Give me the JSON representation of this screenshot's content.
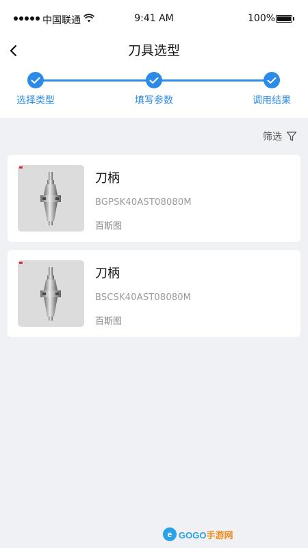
{
  "status_bar": {
    "carrier": "中国联通",
    "time": "9:41 AM",
    "battery": "100%"
  },
  "nav": {
    "title": "刀具选型",
    "back_icon": "chevron-left-icon"
  },
  "steps": [
    {
      "label": "选择类型",
      "completed": true
    },
    {
      "label": "填写参数",
      "completed": true
    },
    {
      "label": "调用结果",
      "completed": true
    }
  ],
  "filter": {
    "label": "筛选",
    "icon": "funnel-icon"
  },
  "results": [
    {
      "name": "刀柄",
      "code": "BGPSK40AST08080M",
      "brand": "百斯图"
    },
    {
      "name": "刀柄",
      "code": "BSCSK40AST08080M",
      "brand": "百斯图"
    }
  ],
  "watermark": {
    "text_main": "GOGO",
    "text_accent": "手游网"
  },
  "colors": {
    "accent": "#2b8be6",
    "background": "#f0f1f5",
    "card": "#ffffff"
  }
}
